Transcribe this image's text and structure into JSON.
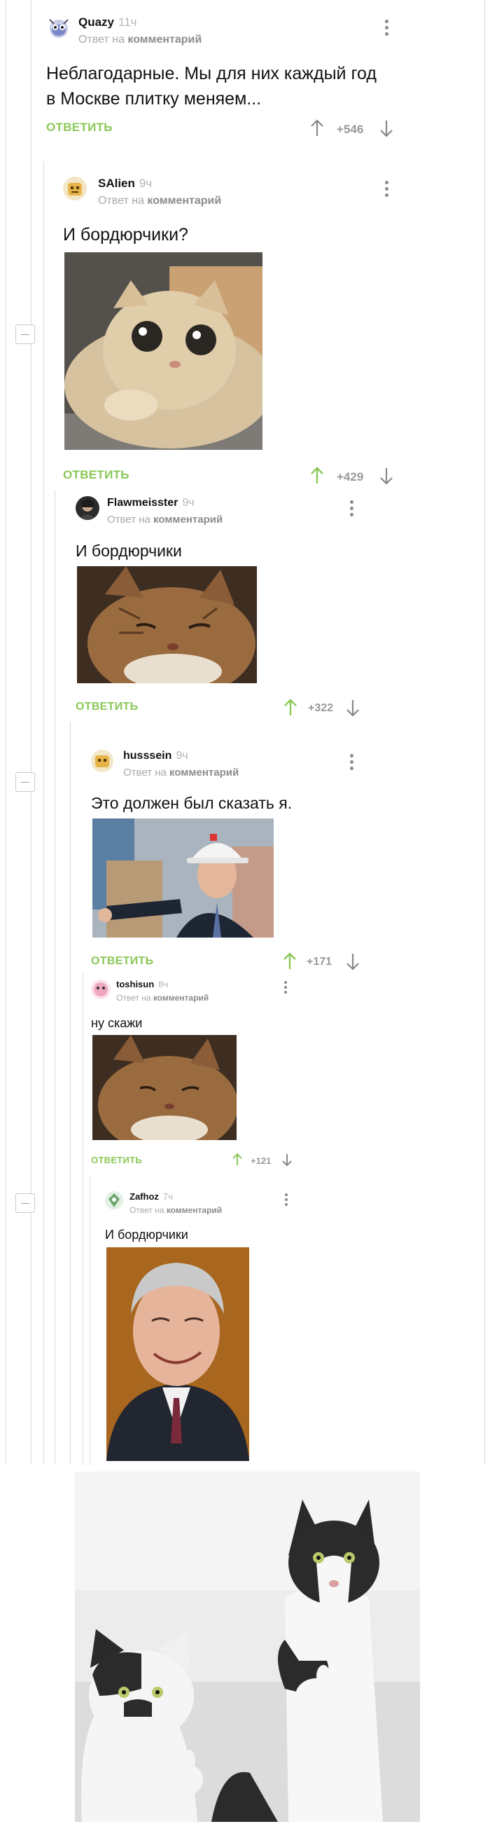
{
  "colors": {
    "accent_green": "#8ac858",
    "meta_gray": "#a8a8a8",
    "rating_gray": "#999999"
  },
  "reply_label": "ОТВЕТИТЬ",
  "comments": [
    {
      "author": "Quazy",
      "time": "11ч",
      "meta_prefix": "Ответ на",
      "meta_link": "комментарий",
      "text_line1": "Неблагодарные. Мы для них каждый год",
      "text_line2": "в Москве плитку меняем...",
      "rating": "+546"
    },
    {
      "author": "SAlien",
      "time": "9ч",
      "meta_prefix": "Ответ на",
      "meta_link": "комментарий",
      "text": "И бордюрчики?",
      "rating": "+429"
    },
    {
      "author": "Flawmeisster",
      "time": "9ч",
      "meta_prefix": "Ответ на",
      "meta_link": "комментарий",
      "text": "И бордюрчики",
      "rating": "+322"
    },
    {
      "author": "husssein",
      "time": "9ч",
      "meta_prefix": "Ответ на",
      "meta_link": "комментарий",
      "text": "Это должен был сказать я.",
      "rating": "+171"
    },
    {
      "author": "toshisun",
      "time": "8ч",
      "meta_prefix": "Ответ на",
      "meta_link": "комментарий",
      "text": "ну скажи",
      "rating": "+121"
    },
    {
      "author": "Zafhoz",
      "time": "7ч",
      "meta_prefix": "Ответ на",
      "meta_link": "комментарий",
      "text": "И бордюрчики"
    }
  ]
}
